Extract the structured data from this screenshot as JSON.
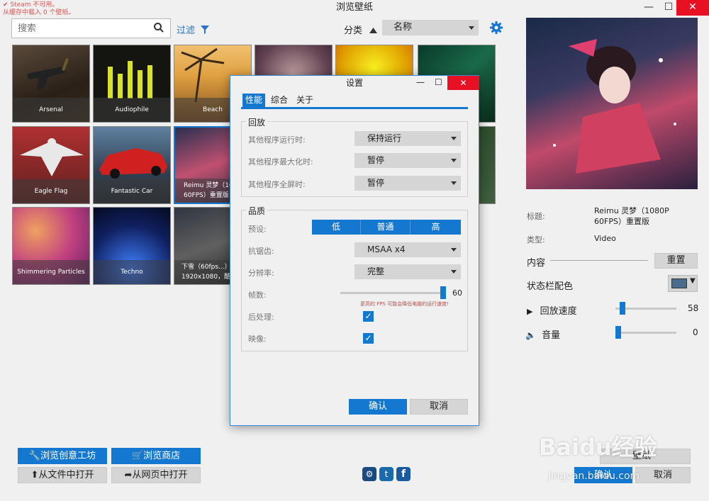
{
  "window": {
    "title": "浏览壁纸",
    "notice_line1": "Steam 不可用。",
    "notice_line2": "从缓存中载入 0 个壁纸。",
    "minimize": "—",
    "maximize": "☐",
    "close": "✕"
  },
  "toolbar": {
    "search_placeholder": "搜索",
    "filter_label": "过滤",
    "category_label": "分类",
    "sort_value": "名称"
  },
  "tiles": [
    {
      "label": "Arsenal"
    },
    {
      "label": "Audiophile"
    },
    {
      "label": "Beach"
    },
    {
      "label": ""
    },
    {
      "label": ""
    },
    {
      "label": ""
    },
    {
      "label": "Eagle Flag"
    },
    {
      "label": "Fantastic Car"
    },
    {
      "label": "Reimu 灵梦（1080P 60FPS）重置版"
    },
    {
      "label": ""
    },
    {
      "label": "Shimmering Particles"
    },
    {
      "label": "Techno"
    },
    {
      "label": "下雪（60fps...）1920x1080，酷..."
    }
  ],
  "details": {
    "title_label": "标题:",
    "title_value_line1": "Reimu 灵梦（1080P",
    "title_value_line2": "60FPS）重置版",
    "type_label": "类型:",
    "type_value": "Video",
    "content_label": "内容",
    "reset_button": "重置",
    "statusbar_color_label": "状态栏配色",
    "statusbar_color": "#4a6c8c",
    "playback_speed_label": "回放速度",
    "playback_speed_value": "58",
    "volume_label": "音量",
    "volume_value": "0"
  },
  "bottom": {
    "workshop_button": "浏览创意工坊",
    "store_button": "浏览商店",
    "open_file_button": "从文件中打开",
    "open_web_button": "从网页中打开",
    "watermark_top": "Baidu经验",
    "watermark_bottom": "jingyan.baidu.com",
    "ok_partial": "确认",
    "cancel_partial": "取消",
    "select_partial": "壁纸"
  },
  "dialog": {
    "title": "设置",
    "tabs": [
      "性能",
      "综合",
      "关于"
    ],
    "playback_group": "回放",
    "other_running_label": "其他程序运行时:",
    "other_running_value": "保持运行",
    "other_maximized_label": "其他程序最大化时:",
    "other_maximized_value": "暂停",
    "other_fullscreen_label": "其他程序全屏时:",
    "other_fullscreen_value": "暂停",
    "quality_group": "品质",
    "preset_label": "预设:",
    "preset_options": [
      "低",
      "普通",
      "高"
    ],
    "aa_label": "抗锯齿:",
    "aa_value": "MSAA x4",
    "resolution_label": "分辨率:",
    "resolution_value": "完整",
    "fps_label": "帧数:",
    "fps_value": "60",
    "fps_hint": "更高的 FPS 可能会降低电脑的运行速度!",
    "postprocess_label": "后处理:",
    "reflection_label": "映像:",
    "ok_button": "确认",
    "cancel_button": "取消"
  }
}
